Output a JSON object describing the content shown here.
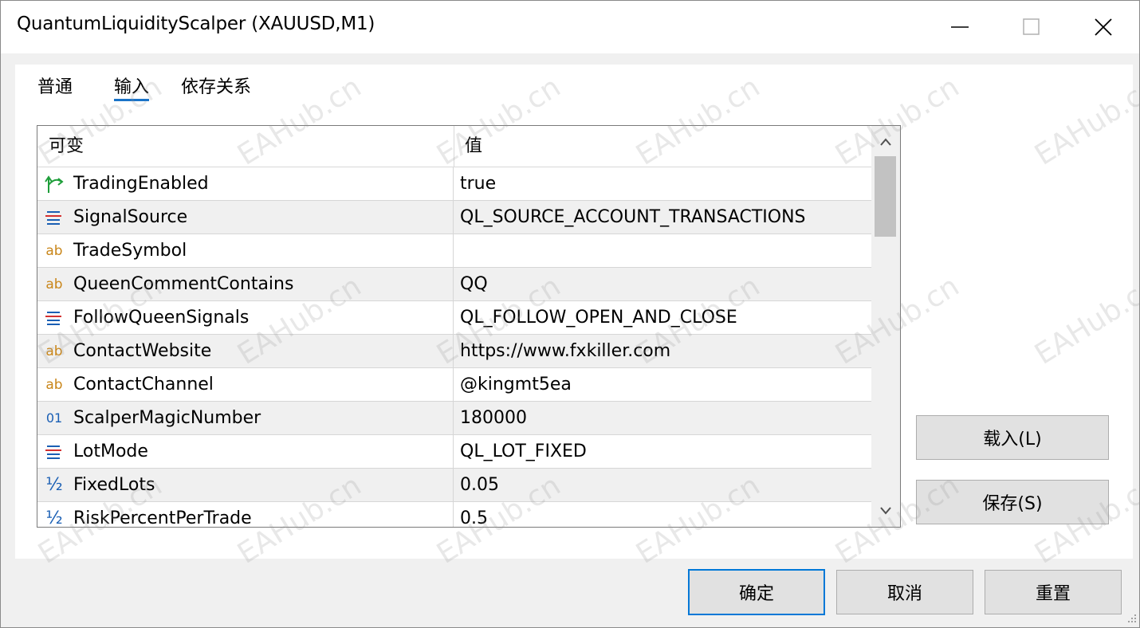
{
  "window": {
    "title": "QuantumLiquidityScalper (XAUUSD,M1)",
    "controls": [
      "minimize",
      "maximize",
      "close"
    ]
  },
  "tabs": [
    {
      "label": "普通",
      "active": false
    },
    {
      "label": "输入",
      "active": true
    },
    {
      "label": "依存关系",
      "active": false
    }
  ],
  "table": {
    "headers": {
      "name": "可变",
      "value": "值"
    },
    "rows": [
      {
        "type_icon": "bool-arrow-icon",
        "name": "TradingEnabled",
        "value": "true"
      },
      {
        "type_icon": "enum-list-icon",
        "name": "SignalSource",
        "value": "QL_SOURCE_ACCOUNT_TRANSACTIONS"
      },
      {
        "type_icon": "string-ab-icon",
        "name": "TradeSymbol",
        "value": ""
      },
      {
        "type_icon": "string-ab-icon",
        "name": "QueenCommentContains",
        "value": "QQ"
      },
      {
        "type_icon": "enum-list-icon",
        "name": "FollowQueenSignals",
        "value": "QL_FOLLOW_OPEN_AND_CLOSE"
      },
      {
        "type_icon": "string-ab-icon",
        "name": "ContactWebsite",
        "value": "https://www.fxkiller.com"
      },
      {
        "type_icon": "string-ab-icon",
        "name": "ContactChannel",
        "value": "@kingmt5ea"
      },
      {
        "type_icon": "integer-01-icon",
        "name": "ScalperMagicNumber",
        "value": "180000"
      },
      {
        "type_icon": "enum-list-icon",
        "name": "LotMode",
        "value": "QL_LOT_FIXED"
      },
      {
        "type_icon": "double-fraction-icon",
        "name": "FixedLots",
        "value": "0.05"
      },
      {
        "type_icon": "double-fraction-icon",
        "name": "RiskPercentPerTrade",
        "value": "0.5"
      }
    ]
  },
  "icon_glyphs": {
    "ab": "ab",
    "int": "01",
    "half": "½"
  },
  "side_buttons": {
    "load": "载入(L)",
    "save": "保存(S)"
  },
  "footer_buttons": {
    "ok": "确定",
    "cancel": "取消",
    "reset": "重置"
  },
  "watermark": "EAHub.cn",
  "colors": {
    "bool": "#1e9e3a",
    "enum": "#1a5fb4",
    "enum_red": "#d33030",
    "string": "#c9861a",
    "int": "#1a5fb4",
    "double": "#1a5fb4",
    "focus": "#0078d7"
  }
}
